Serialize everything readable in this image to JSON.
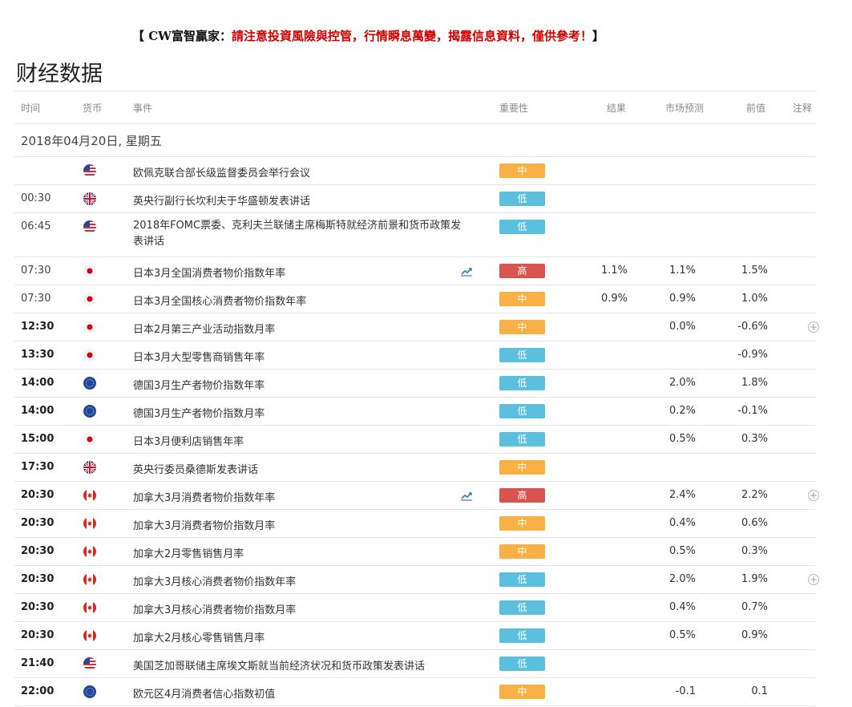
{
  "notice": {
    "prefix": "【 CW富智贏家：",
    "warning": "請注意投資風險與控管，行情瞬息萬變，揭露信息資料，僅供參考！",
    "suffix": "】"
  },
  "page_title": "财经数据",
  "headers": {
    "time": "时间",
    "currency": "货币",
    "event": "事件",
    "importance": "重要性",
    "actual": "结果",
    "forecast": "市场预测",
    "previous": "前值",
    "note": "注释"
  },
  "date_label": "2018年04月20日, 星期五",
  "colors": {
    "mid": "#f9b045",
    "low": "#5bc0de",
    "high": "#d9534f",
    "divider": "#e5e5e5"
  },
  "rows": [
    {
      "time": "",
      "flag": "us",
      "event": "欧佩克联合部长级监督委员会举行会议",
      "importance": "中",
      "level": "mid",
      "actual": "",
      "forecast": "",
      "previous": "",
      "chart": false,
      "note": false,
      "bold": false
    },
    {
      "time": "00:30",
      "flag": "uk",
      "event": "英央行副行长坎利夫于华盛顿发表讲话",
      "importance": "低",
      "level": "low",
      "actual": "",
      "forecast": "",
      "previous": "",
      "chart": false,
      "note": false,
      "bold": false
    },
    {
      "time": "06:45",
      "flag": "us",
      "event": "2018年FOMC票委、克利夫兰联储主席梅斯特就经济前景和货币政策发表讲话",
      "importance": "低",
      "level": "low",
      "actual": "",
      "forecast": "",
      "previous": "",
      "chart": false,
      "note": false,
      "bold": false,
      "tall": true
    },
    {
      "time": "07:30",
      "flag": "jp",
      "event": "日本3月全国消费者物价指数年率",
      "importance": "高",
      "level": "high",
      "actual": "1.1%",
      "forecast": "1.1%",
      "previous": "1.5%",
      "chart": true,
      "note": false,
      "bold": false
    },
    {
      "time": "07:30",
      "flag": "jp",
      "event": "日本3月全国核心消费者物价指数年率",
      "importance": "中",
      "level": "mid",
      "actual": "0.9%",
      "forecast": "0.9%",
      "previous": "1.0%",
      "chart": false,
      "note": false,
      "bold": false
    },
    {
      "time": "12:30",
      "flag": "jp",
      "event": "日本2月第三产业活动指数月率",
      "importance": "中",
      "level": "mid",
      "actual": "",
      "forecast": "0.0%",
      "previous": "-0.6%",
      "chart": false,
      "note": true,
      "bold": true
    },
    {
      "time": "13:30",
      "flag": "jp",
      "event": "日本3月大型零售商销售年率",
      "importance": "低",
      "level": "low",
      "actual": "",
      "forecast": "",
      "previous": "-0.9%",
      "chart": false,
      "note": false,
      "bold": true
    },
    {
      "time": "14:00",
      "flag": "eu",
      "event": "德国3月生产者物价指数年率",
      "importance": "低",
      "level": "low",
      "actual": "",
      "forecast": "2.0%",
      "previous": "1.8%",
      "chart": false,
      "note": false,
      "bold": true
    },
    {
      "time": "14:00",
      "flag": "eu",
      "event": "德国3月生产者物价指数月率",
      "importance": "低",
      "level": "low",
      "actual": "",
      "forecast": "0.2%",
      "previous": "-0.1%",
      "chart": false,
      "note": false,
      "bold": true
    },
    {
      "time": "15:00",
      "flag": "jp",
      "event": "日本3月便利店销售年率",
      "importance": "低",
      "level": "low",
      "actual": "",
      "forecast": "0.5%",
      "previous": "0.3%",
      "chart": false,
      "note": false,
      "bold": true
    },
    {
      "time": "17:30",
      "flag": "uk",
      "event": "英央行委员桑德斯发表讲话",
      "importance": "中",
      "level": "mid",
      "actual": "",
      "forecast": "",
      "previous": "",
      "chart": false,
      "note": false,
      "bold": true
    },
    {
      "time": "20:30",
      "flag": "ca",
      "event": "加拿大3月消费者物价指数年率",
      "importance": "高",
      "level": "high",
      "actual": "",
      "forecast": "2.4%",
      "previous": "2.2%",
      "chart": true,
      "note": true,
      "bold": true
    },
    {
      "time": "20:30",
      "flag": "ca",
      "event": "加拿大3月消费者物价指数月率",
      "importance": "中",
      "level": "mid",
      "actual": "",
      "forecast": "0.4%",
      "previous": "0.6%",
      "chart": false,
      "note": false,
      "bold": true
    },
    {
      "time": "20:30",
      "flag": "ca",
      "event": "加拿大2月零售销售月率",
      "importance": "中",
      "level": "mid",
      "actual": "",
      "forecast": "0.5%",
      "previous": "0.3%",
      "chart": false,
      "note": false,
      "bold": true
    },
    {
      "time": "20:30",
      "flag": "ca",
      "event": "加拿大3月核心消费者物价指数年率",
      "importance": "低",
      "level": "low",
      "actual": "",
      "forecast": "2.0%",
      "previous": "1.9%",
      "chart": false,
      "note": true,
      "bold": true
    },
    {
      "time": "20:30",
      "flag": "ca",
      "event": "加拿大3月核心消费者物价指数月率",
      "importance": "低",
      "level": "low",
      "actual": "",
      "forecast": "0.4%",
      "previous": "0.7%",
      "chart": false,
      "note": false,
      "bold": true
    },
    {
      "time": "20:30",
      "flag": "ca",
      "event": "加拿大2月核心零售销售月率",
      "importance": "低",
      "level": "low",
      "actual": "",
      "forecast": "0.5%",
      "previous": "0.9%",
      "chart": false,
      "note": false,
      "bold": true
    },
    {
      "time": "21:40",
      "flag": "us",
      "event": "美国芝加哥联储主席埃文斯就当前经济状况和货币政策发表讲话",
      "importance": "低",
      "level": "low",
      "actual": "",
      "forecast": "",
      "previous": "",
      "chart": false,
      "note": false,
      "bold": true
    },
    {
      "time": "22:00",
      "flag": "eu",
      "event": "欧元区4月消费者信心指数初值",
      "importance": "中",
      "level": "mid",
      "actual": "",
      "forecast": "-0.1",
      "previous": "0.1",
      "chart": false,
      "note": false,
      "bold": true
    }
  ]
}
